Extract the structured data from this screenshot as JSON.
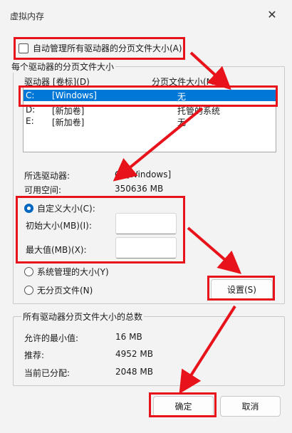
{
  "window": {
    "title": "虚拟内存",
    "close_icon": "close-icon"
  },
  "auto_manage": {
    "label": "自动管理所有驱动器的分页文件大小(A)",
    "checked": false
  },
  "drive_group": {
    "title": "每个驱动器的分页文件大小",
    "col_drive": "驱动器 [卷标](D)",
    "col_size": "分页文件大小(MB)",
    "rows": [
      {
        "drive": "C:",
        "label": "[Windows]",
        "size": "无",
        "selected": true
      },
      {
        "drive": "D:",
        "label": "[新加卷]",
        "size": "托管的系统",
        "selected": false
      },
      {
        "drive": "E:",
        "label": "[新加卷]",
        "size": "无",
        "selected": false
      }
    ]
  },
  "selected_drive": {
    "label": "所选驱动器:",
    "value": "C:  [Windows]"
  },
  "free_space": {
    "label": "可用空间:",
    "value": "350636 MB"
  },
  "custom_size": {
    "label": "自定义大小(C):",
    "initial_label": "初始大小(MB)(I):",
    "initial_value": "",
    "max_label": "最大值(MB)(X):",
    "max_value": ""
  },
  "system_managed": {
    "label": "系统管理的大小(Y)"
  },
  "no_paging": {
    "label": "无分页文件(N)"
  },
  "set_button": "设置(S)",
  "totals": {
    "title": "所有驱动器分页文件大小的总数",
    "min_label": "允许的最小值:",
    "min_value": "16 MB",
    "recommended_label": "推荐:",
    "recommended_value": "4952 MB",
    "current_label": "当前已分配:",
    "current_value": "2048 MB"
  },
  "ok_button": "确定",
  "cancel_button": "取消",
  "annotation_color": "#e8121a",
  "selection_color": "#0078d7"
}
